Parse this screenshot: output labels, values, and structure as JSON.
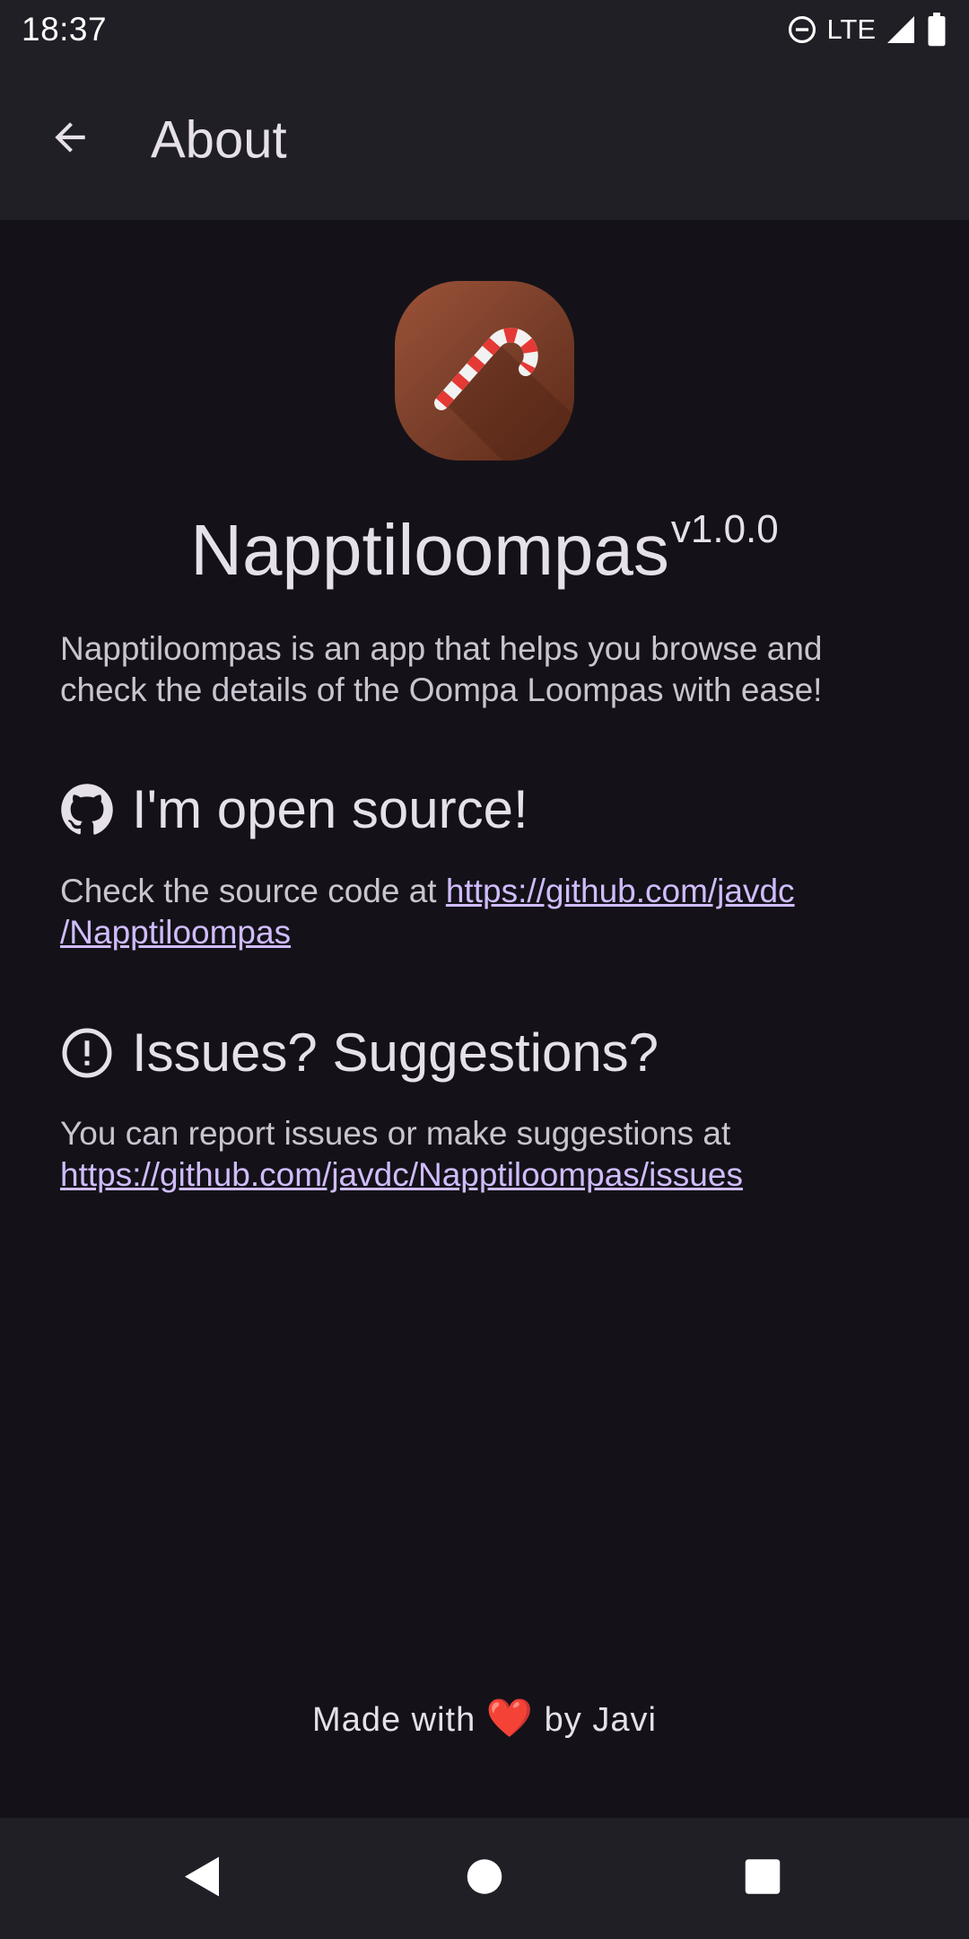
{
  "status_bar": {
    "time": "18:37",
    "network": "LTE",
    "icons": [
      "do-not-disturb-icon",
      "signal-icon",
      "battery-icon"
    ]
  },
  "app_bar": {
    "title": "About",
    "back_icon": "arrow-back-icon"
  },
  "about": {
    "app_icon": "candy-cane-icon",
    "app_name": "Napptiloompas",
    "version": "v1.0.0",
    "description": "Napptiloompas is an app that helps you browse and check the details of the Oompa Loompas with ease!"
  },
  "open_source": {
    "icon": "github-icon",
    "heading": "I'm open source!",
    "text": "Check the source code at ",
    "link_line1": "https://github.com/javdc",
    "link_line2": "/Napptiloompas"
  },
  "issues": {
    "icon": "info-icon",
    "heading": "Issues? Suggestions?",
    "text": "You can report issues or make suggestions at",
    "link": "https://github.com/javdc/Napptiloompas/issues"
  },
  "footer": {
    "prefix": "Made with",
    "heart": "❤️",
    "suffix": "by Javi"
  },
  "nav_bar": {
    "icons": [
      "back-triangle-icon",
      "home-circle-icon",
      "recents-square-icon"
    ]
  },
  "colors": {
    "background": "#141218",
    "surface": "#211f26",
    "link": "#d0bcff",
    "text": "#e6e0e9"
  }
}
